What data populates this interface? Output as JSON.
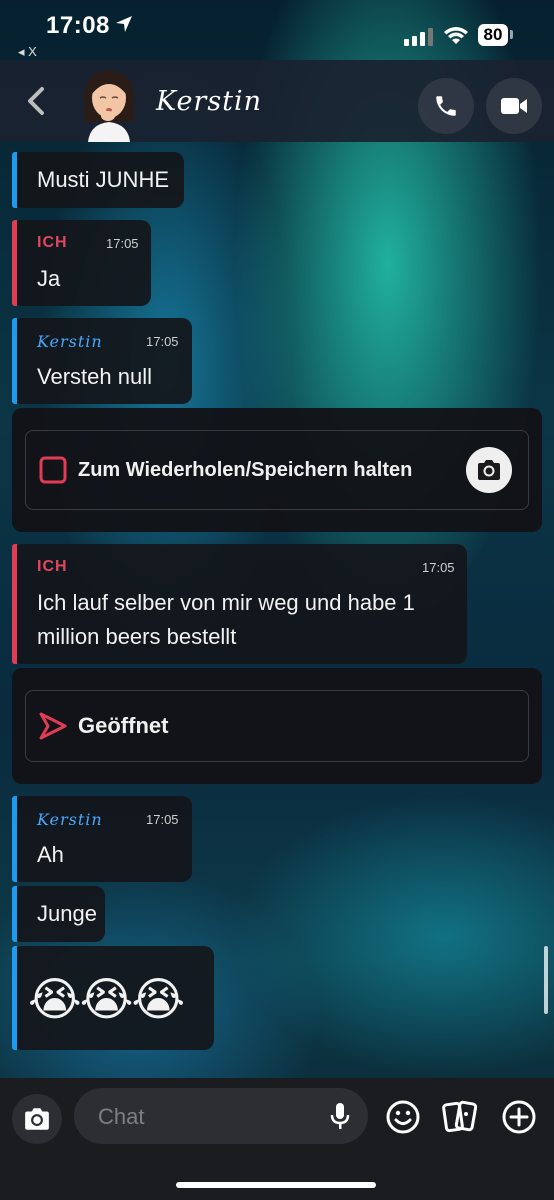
{
  "status": {
    "time": "17:08",
    "back_app": "◂ X",
    "battery": "80"
  },
  "header": {
    "contact_name": "Kerstin",
    "icons": [
      "back-chevron-icon",
      "phone-icon",
      "video-camera-icon"
    ]
  },
  "messages": [
    {
      "text": "Musti JUNHE"
    },
    {
      "sender": "ICH",
      "time": "17:05",
      "text": "Ja"
    },
    {
      "sender": "Kerstin",
      "time": "17:05",
      "text": "Versteh null"
    },
    {
      "sender": "ICH",
      "time": "17:05",
      "text_line1": "Ich lauf selber von mir weg und habe 1",
      "text_line2": "million beers bestellt"
    },
    {
      "sender": "Kerstin",
      "time": "17:05",
      "text": "Ah"
    },
    {
      "text": "Junge"
    },
    {
      "text": "😭😭😭"
    }
  ],
  "snap_cards": {
    "hold_label": "Zum Wiederholen/Speichern halten",
    "opened_label": "Geöffnet"
  },
  "composer": {
    "placeholder": "Chat",
    "icons": [
      "camera-icon",
      "microphone-icon",
      "emoji-icon",
      "stickers-icon",
      "plus-icon"
    ]
  },
  "colors": {
    "me": "#e0475e",
    "them": "#46a8ff",
    "bar_blue": "#1e9bf0",
    "bar_red": "#e23c54"
  }
}
